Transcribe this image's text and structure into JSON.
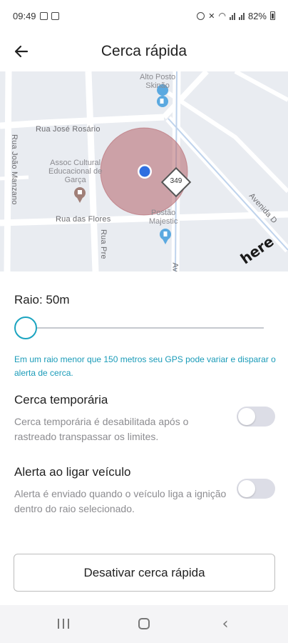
{
  "status_bar": {
    "time": "09:49",
    "battery": "82%"
  },
  "app_bar": {
    "title": "Cerca rápida",
    "back_icon": "arrow-left"
  },
  "map": {
    "streets": [
      "Rua José Rosário",
      "Rua das Flores",
      "Rua João Manzano",
      "Rua Pre",
      "Av",
      "Avenida D"
    ],
    "pois": [
      {
        "name": "Alto Posto Skinão",
        "lines": [
          "Alto Posto",
          "Skinão"
        ]
      },
      {
        "name": "Assoc Cultural Educacional de Garça",
        "lines": [
          "Assoc Cultural",
          "Educacional de",
          "Garça"
        ]
      },
      {
        "name": "Postão Majestic",
        "lines": [
          "Postão",
          "Majestic"
        ]
      }
    ],
    "route_number": "349",
    "provider": "here",
    "fence_color": "#b5646a",
    "location_color": "#2f6fe0"
  },
  "radius": {
    "label": "Raio: 50m",
    "slider_value": 50,
    "hint": "Em um raio menor que 150 metros seu GPS pode variar e disparar o alerta de cerca."
  },
  "temporary_fence": {
    "title": "Cerca temporária",
    "description": "Cerca temporária é desabilitada após o rastreado transpassar os limites.",
    "enabled": false
  },
  "ignition_alert": {
    "title": "Alerta ao ligar veículo",
    "description": "Alerta é enviado quando o veículo liga a ignição dentro do raio selecionado.",
    "enabled": false
  },
  "actions": {
    "deactivate_label": "Desativar cerca rápida"
  },
  "colors": {
    "accent": "#1ba4c0",
    "hint_text": "#1a9bb8",
    "toggle_off": "#dcdde6"
  },
  "nav_bar": {
    "recents_icon": "recents",
    "home_icon": "home",
    "back_icon": "chevron-left"
  }
}
